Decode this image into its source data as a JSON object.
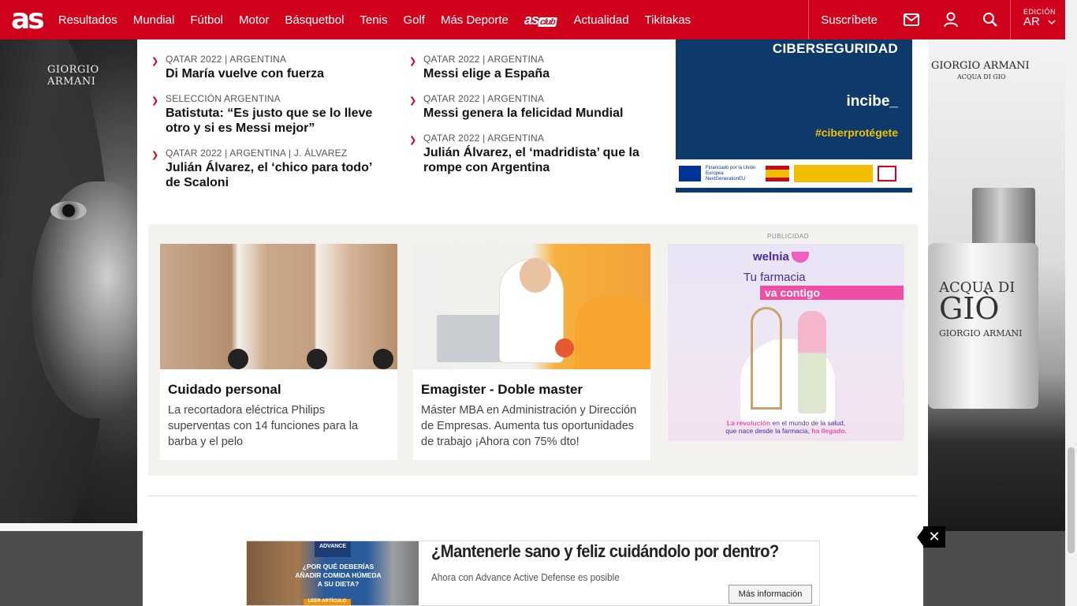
{
  "nav": {
    "logo": "as",
    "items": [
      "Resultados",
      "Mundial",
      "Fútbol",
      "Motor",
      "Básquetbol",
      "Tenis",
      "Golf",
      "Más Deporte"
    ],
    "club_logo": "as",
    "club_tag": "club",
    "items2": [
      "Actualidad",
      "Tikitakas"
    ],
    "subscribe": "Suscríbete",
    "edition_label": "EDICIÓN",
    "edition_value": "AR"
  },
  "news_left": [
    {
      "kicker": "QATAR 2022 | ARGENTINA",
      "headline": "Di María vuelve con fuerza"
    },
    {
      "kicker": "SELECCIÓN ARGENTINA",
      "headline": "Batistuta: “Es justo que se lo lleve otro y si es Messi mejor”"
    },
    {
      "kicker": "QATAR 2022 | ARGENTINA | J. ÁLVAREZ",
      "headline": "Julián Álvarez, el ‘chico para todo’ de Scaloni"
    }
  ],
  "news_right": [
    {
      "kicker": "QATAR 2022 | ARGENTINA",
      "headline": "Messi elige a España"
    },
    {
      "kicker": "QATAR 2022 | ARGENTINA",
      "headline": "Messi genera la felicidad Mundial"
    },
    {
      "kicker": "QATAR 2022 | ARGENTINA",
      "headline": "Julián Álvarez, el ‘madridista’ que la rompe con Argentina"
    }
  ],
  "incibe_ad": {
    "title": "CIBERSEGURIDAD",
    "logo": "incibe_",
    "hashtag": "#ciberprotégete",
    "eu_text": "Financiado por la Unión Europea NextGenerationEU"
  },
  "promos": [
    {
      "title": "Cuidado personal",
      "desc": "La recortadora eléctrica Philips superventas con 14 funciones para la barba y el pelo"
    },
    {
      "title": "Emagister - Doble master",
      "desc": "Máster MBA en Administración y Dirección de Empresas. Aumenta tus oportunidades de trabajo ¡Ahora con 75% dto!"
    }
  ],
  "publicidad_label": "PUBLICIDAD",
  "welnia_ad": {
    "brand": "welnia",
    "line1": "Tu farmacia",
    "line2": "va contigo",
    "footer_a": "La revolución",
    "footer_b": " en el mundo de la salud,",
    "footer_c": "que nace desde la farmacia, ",
    "footer_d": "ha llegado."
  },
  "skin_left": {
    "brand": "GIORGIO ARMANI"
  },
  "skin_right": {
    "brand": "GIORGIO ARMANI",
    "sub": "ACQUA DI GIO",
    "bottle_l1": "ACQUA DI",
    "bottle_l2": "GIÒ",
    "bottle_l3": "GIORGIO ARMANI"
  },
  "bottom_ad": {
    "badge": "ADVANCE",
    "question": "¿POR QUÉ DEBERÍAS AÑADIR COMIDA HÚMEDA A SU DIETA?",
    "cta_small": "LEER ARTÍCULO",
    "headline": "¿Mantenerle sano y feliz cuidándolo por dentro?",
    "sub": "Ahora con Advance Active Defense es posible",
    "button": "Más información",
    "close": "✕"
  },
  "colors": {
    "brand_red": "#d0021b",
    "incibe_blue": "#0d3a6b",
    "welnia_purple": "#4b2b9a",
    "welnia_pink": "#ec4fa3"
  }
}
